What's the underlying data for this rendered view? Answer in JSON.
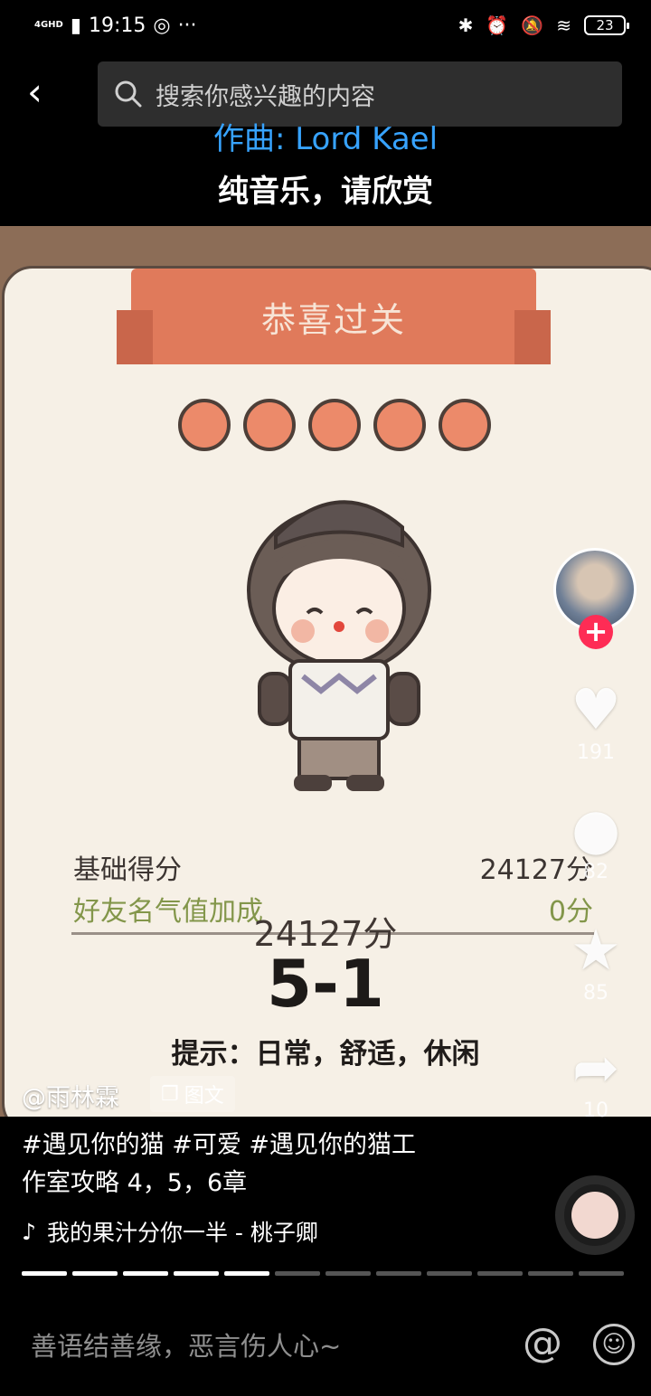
{
  "status_bar": {
    "network": "4GHD",
    "time": "19:15",
    "battery": "23"
  },
  "search": {
    "placeholder": "搜索你感兴趣的内容"
  },
  "video": {
    "credit": "作曲: Lord Kael",
    "subtitle": "纯音乐，请欣赏",
    "banner": "恭喜过关",
    "stars": 5,
    "base_score_label": "基础得分",
    "base_score_value": "24127分",
    "friend_bonus_label": "好友名气值加成",
    "friend_bonus_value": "0分",
    "total": "24127分",
    "level": "5-1",
    "hint": "提示：日常，舒适，休闲",
    "author": "@雨林霖",
    "type_label": "图文"
  },
  "actions": {
    "likes": "191",
    "comments": "82",
    "favorites": "85",
    "shares": "10"
  },
  "caption": {
    "line1": "#遇见你的猫 #可爱 #遇见你的猫工",
    "line2": "作室攻略 4，5，6章"
  },
  "music": {
    "title": "我的果汁分你一半 - 桃子卿"
  },
  "progress": {
    "total": 12,
    "current": 5
  },
  "comment_bar": {
    "placeholder": "善语结善缘，恶言伤人心~",
    "at": "@"
  },
  "colors": {
    "accent_follow": "#fe2c55",
    "credit": "#37a3ff",
    "banner": "#e07a5b",
    "bonus": "#83964a"
  }
}
